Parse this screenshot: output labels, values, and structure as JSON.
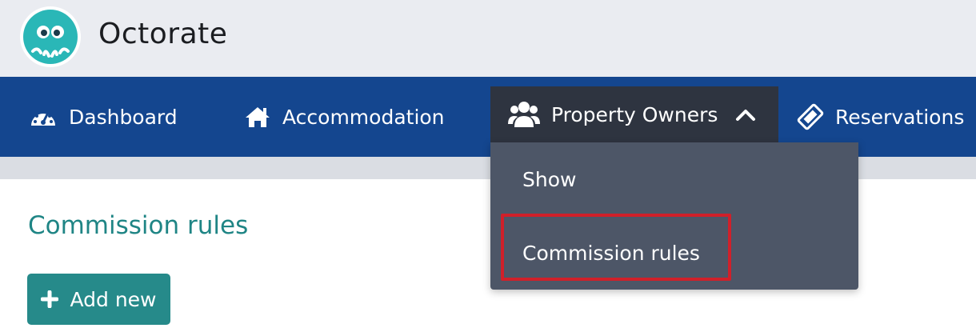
{
  "header": {
    "brand": "Octorate",
    "logo_icon": "octopus-logo-icon",
    "logo_color": "#2ab7b7"
  },
  "nav": {
    "items": [
      {
        "label": "Dashboard",
        "icon": "dashboard-gauge-icon"
      },
      {
        "label": "Accommodation",
        "icon": "home-icon"
      },
      {
        "label": "Property Owners",
        "icon": "users-icon",
        "active": true
      },
      {
        "label": "Reservations",
        "icon": "ticket-icon"
      }
    ],
    "background": "#14468f",
    "active_background": "#2e3440"
  },
  "dropdown": {
    "items": [
      {
        "label": "Show"
      },
      {
        "label": "Commission rules",
        "highlighted": true
      }
    ],
    "background": "#4d5667",
    "highlight_color": "#d0202a"
  },
  "page": {
    "title": "Commission rules",
    "add_button_label": "Add new",
    "accent": "#268a8a"
  }
}
